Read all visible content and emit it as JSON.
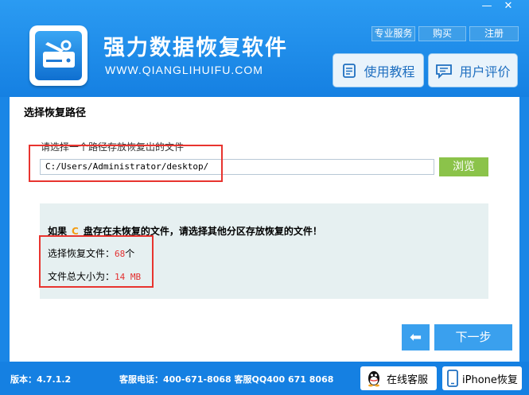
{
  "header": {
    "title": "强力数据恢复软件",
    "url": "WWW.QIANGLIHUIFU.COM",
    "window_controls": {
      "minimize": "—",
      "close": "✕"
    },
    "links": [
      "专业服务",
      "购买",
      "注册"
    ],
    "tutorial_label": "使用教程",
    "review_label": "用户评价"
  },
  "main": {
    "section_title": "选择恢复路径",
    "path_label": "请选择一个路径存放恢复出的文件",
    "path_value": "C:/Users/Administrator/desktop/",
    "browse_label": "浏览",
    "warning_prefix": "如果",
    "drive": "C",
    "warning_suffix": "盘存在未恢复的文件，请选择其他分区存放恢复的文件！",
    "file_count_label": "选择恢复文件：",
    "file_count_value": "68",
    "file_count_unit": "个",
    "total_size_label": "文件总大小为：",
    "total_size_value": "14 MB",
    "back_symbol": "⬅",
    "next_label": "下一步"
  },
  "footer": {
    "version": "版本：4.7.1.2",
    "phone": "客服电话：400-671-8068 客服QQ400 671 8068",
    "online_service_label": "在线客服",
    "iphone_label": "iPhone恢复"
  },
  "colors": {
    "brand_blue": "#1a86e6",
    "browse_green": "#8bc34a",
    "highlight_red": "#e8342f",
    "drive_orange": "#f39c12"
  }
}
